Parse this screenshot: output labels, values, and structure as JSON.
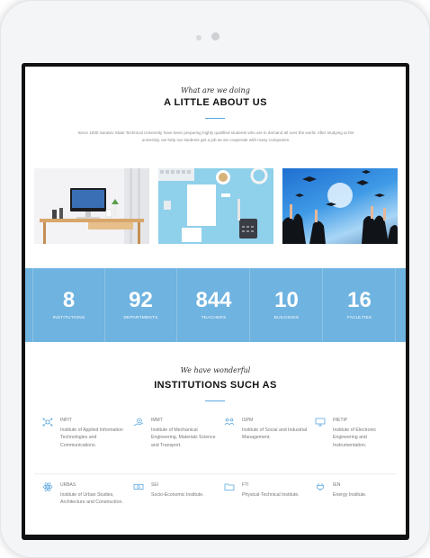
{
  "about": {
    "kicker": "What are we doing",
    "title": "A LITTLE ABOUT US",
    "text": "Since 1930 Saratov State Technical University have been preparing highly qualified students who are in demand all over the world. After studying at the university, we help our students get a job as we cooperate with many companies."
  },
  "stats": [
    {
      "value": "8",
      "label": "INSTITUTIONS"
    },
    {
      "value": "92",
      "label": "DEPARTMENTS"
    },
    {
      "value": "844",
      "label": "TEACHERS"
    },
    {
      "value": "10",
      "label": "BUILDINGS"
    },
    {
      "value": "16",
      "label": "FACULTIES"
    }
  ],
  "institutions": {
    "kicker": "We have wonderful",
    "title": "INSTITUTIONS SUCH AS",
    "items": [
      {
        "code": "INPIT",
        "desc": "Institute of Applied Information Technologies and Communications.",
        "icon": "network-icon"
      },
      {
        "code": "IMMT",
        "desc": "Institute of Mechanical Engineering, Materials Science and Transport.",
        "icon": "gear-hand-icon"
      },
      {
        "code": "ISPM",
        "desc": "Institute of Social and Industrial Management.",
        "icon": "people-icon"
      },
      {
        "code": "IНЕТIP",
        "desc": "Institute of Electronic Engineering and Instrumentation.",
        "icon": "monitor-icon"
      },
      {
        "code": "URBAS",
        "desc": "Institute of Urban Studies, Architecture and Construction.",
        "icon": "atom-icon"
      },
      {
        "code": "SEI",
        "desc": "Socio-Economic Institute.",
        "icon": "cash-icon"
      },
      {
        "code": "FTI",
        "desc": "Physical-Technical Institute.",
        "icon": "folder-icon"
      },
      {
        "code": "IEN",
        "desc": "Energy Institute.",
        "icon": "plug-icon"
      }
    ]
  },
  "colors": {
    "accent": "#6fb3e0",
    "icon": "#5aa7de"
  }
}
